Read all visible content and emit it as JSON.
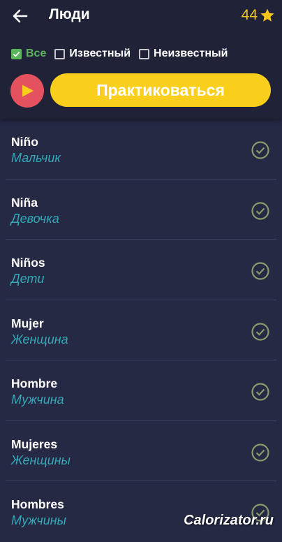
{
  "header": {
    "title": "Люди",
    "back_icon": "arrow-left-icon",
    "score": "44",
    "score_icon": "star-icon"
  },
  "filters": [
    {
      "label": "Все",
      "checked": true
    },
    {
      "label": "Известный",
      "checked": false
    },
    {
      "label": "Неизвестный",
      "checked": false
    }
  ],
  "actions": {
    "play_icon": "play-icon",
    "practice_label": "Практиковаться"
  },
  "words": [
    {
      "word": "Niño",
      "translation": "Мальчик",
      "known": true
    },
    {
      "word": "Niña",
      "translation": "Девочка",
      "known": true
    },
    {
      "word": "Niños",
      "translation": "Дети",
      "known": true
    },
    {
      "word": "Mujer",
      "translation": "Женщина",
      "known": true
    },
    {
      "word": "Hombre",
      "translation": "Мужчина",
      "known": true
    },
    {
      "word": "Mujeres",
      "translation": "Женщины",
      "known": true
    },
    {
      "word": "Hombres",
      "translation": "Мужчины",
      "known": true
    }
  ],
  "watermark": "Calorizator.ru",
  "colors": {
    "background": "#252944",
    "header": "#202338",
    "accent_yellow": "#f9cf1b",
    "play_red": "#e5525f",
    "checkbox_green": "#5bb55b",
    "translation_teal": "#33a9b8",
    "known_check": "#8a9a6a"
  }
}
